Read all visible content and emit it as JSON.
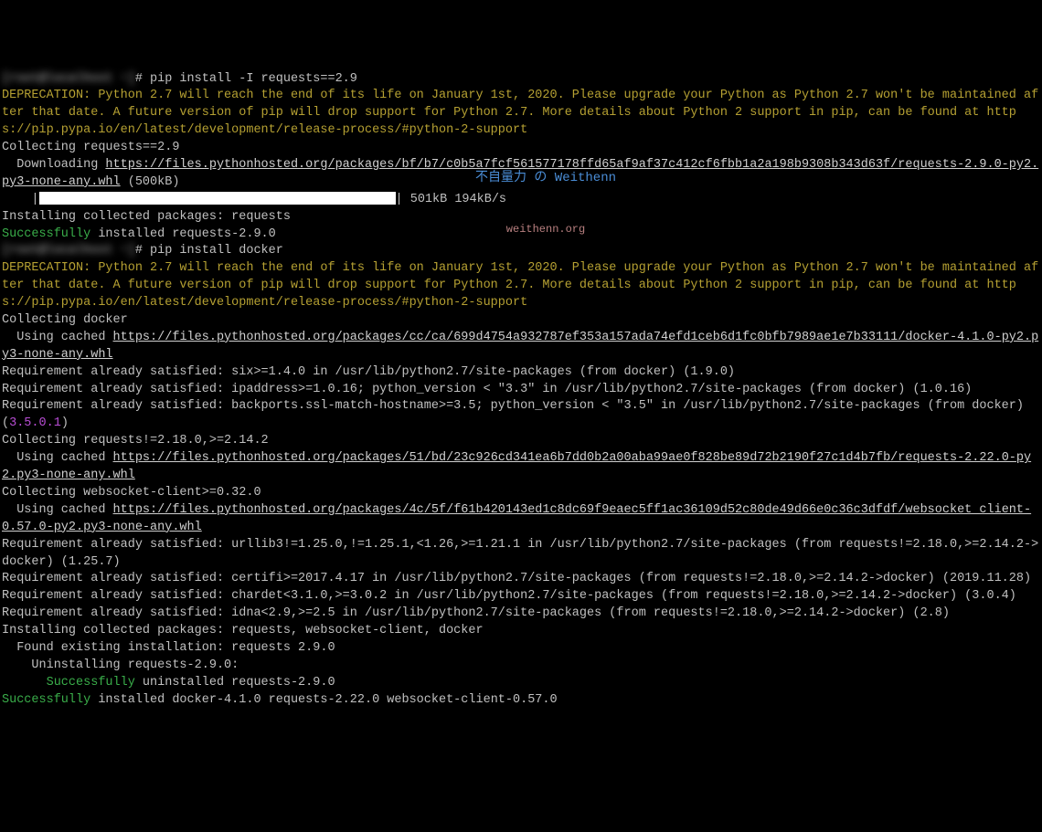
{
  "prompt1_host": "[root@localhost ~]",
  "prompt1_cmd": "# pip install -I requests==2.9",
  "deprecation1": "DEPRECATION: Python 2.7 will reach the end of its life on January 1st, 2020. Please upgrade your Python as Python 2.7 won't be maintained after that date. A future version of pip will drop support for Python 2.7. More details about Python 2 support in pip, can be found at https://pip.pypa.io/en/latest/development/release-process/#python-2-support",
  "collecting_req": "Collecting requests==2.9",
  "downloading": "  Downloading ",
  "download_url": "https://files.pythonhosted.org/packages/bf/b7/c0b5a7fcf561577178ffd65af9af37c412cf6fbb1a2a198b9308b343d63f/requests-2.9.0-py2.py3-none-any.whl",
  "download_size": " (500kB)",
  "progress_prefix": "    |",
  "progress_suffix": "| 501kB 194kB/s",
  "installing_req": "Installing collected packages: requests",
  "success_req_label": "Successfully",
  "success_req_rest": " installed requests-2.9.0",
  "prompt2_host": "[root@localhost ~]",
  "prompt2_cmd": "# pip install docker",
  "deprecation2": "DEPRECATION: Python 2.7 will reach the end of its life on January 1st, 2020. Please upgrade your Python as Python 2.7 won't be maintained after that date. A future version of pip will drop support for Python 2.7. More details about Python 2 support in pip, can be found at https://pip.pypa.io/en/latest/development/release-process/#python-2-support",
  "collecting_docker": "Collecting docker",
  "cached_docker_prefix": "  Using cached ",
  "cached_docker_url": "https://files.pythonhosted.org/packages/cc/ca/699d4754a932787ef353a157ada74efd1ceb6d1fc0bfb7989ae1e7b33111/docker-4.1.0-py2.py3-none-any.whl",
  "req_six": "Requirement already satisfied: six>=1.4.0 in /usr/lib/python2.7/site-packages (from docker) (1.9.0)",
  "req_ipaddr": "Requirement already satisfied: ipaddress>=1.0.16; python_version < \"3.3\" in /usr/lib/python2.7/site-packages (from docker) (1.0.16)",
  "req_ssl_prefix": "Requirement already satisfied: backports.ssl-match-hostname>=3.5; python_version < \"3.5\" in /usr/lib/python2.7/site-packages (from docker) (",
  "req_ssl_version": "3.5.0.1",
  "req_ssl_suffix": ")",
  "collecting_requests": "Collecting requests!=2.18.0,>=2.14.2",
  "cached_req_prefix": "  Using cached ",
  "cached_req_url": "https://files.pythonhosted.org/packages/51/bd/23c926cd341ea6b7dd0b2a00aba99ae0f828be89d72b2190f27c1d4b7fb/requests-2.22.0-py2.py3-none-any.whl",
  "collecting_ws": "Collecting websocket-client>=0.32.0",
  "cached_ws_prefix": "  Using cached ",
  "cached_ws_url": "https://files.pythonhosted.org/packages/4c/5f/f61b420143ed1c8dc69f9eaec5ff1ac36109d52c80de49d66e0c36c3dfdf/websocket_client-0.57.0-py2.py3-none-any.whl",
  "req_urllib3": "Requirement already satisfied: urllib3!=1.25.0,!=1.25.1,<1.26,>=1.21.1 in /usr/lib/python2.7/site-packages (from requests!=2.18.0,>=2.14.2->docker) (1.25.7)",
  "req_certifi": "Requirement already satisfied: certifi>=2017.4.17 in /usr/lib/python2.7/site-packages (from requests!=2.18.0,>=2.14.2->docker) (2019.11.28)",
  "req_chardet": "Requirement already satisfied: chardet<3.1.0,>=3.0.2 in /usr/lib/python2.7/site-packages (from requests!=2.18.0,>=2.14.2->docker) (3.0.4)",
  "req_idna": "Requirement already satisfied: idna<2.9,>=2.5 in /usr/lib/python2.7/site-packages (from requests!=2.18.0,>=2.14.2->docker) (2.8)",
  "installing_docker": "Installing collected packages: requests, websocket-client, docker",
  "found_existing": "  Found existing installation: requests 2.9.0",
  "uninstalling": "    Uninstalling requests-2.9.0:",
  "uninstall_indent": "      ",
  "uninstall_success": "Successfully",
  "uninstall_rest": " uninstalled requests-2.9.0",
  "final_success": "Successfully",
  "final_rest": " installed docker-4.1.0 requests-2.22.0 websocket-client-0.57.0",
  "watermark_title": "不自量力 の Weithenn",
  "watermark_url": "weithenn.org"
}
